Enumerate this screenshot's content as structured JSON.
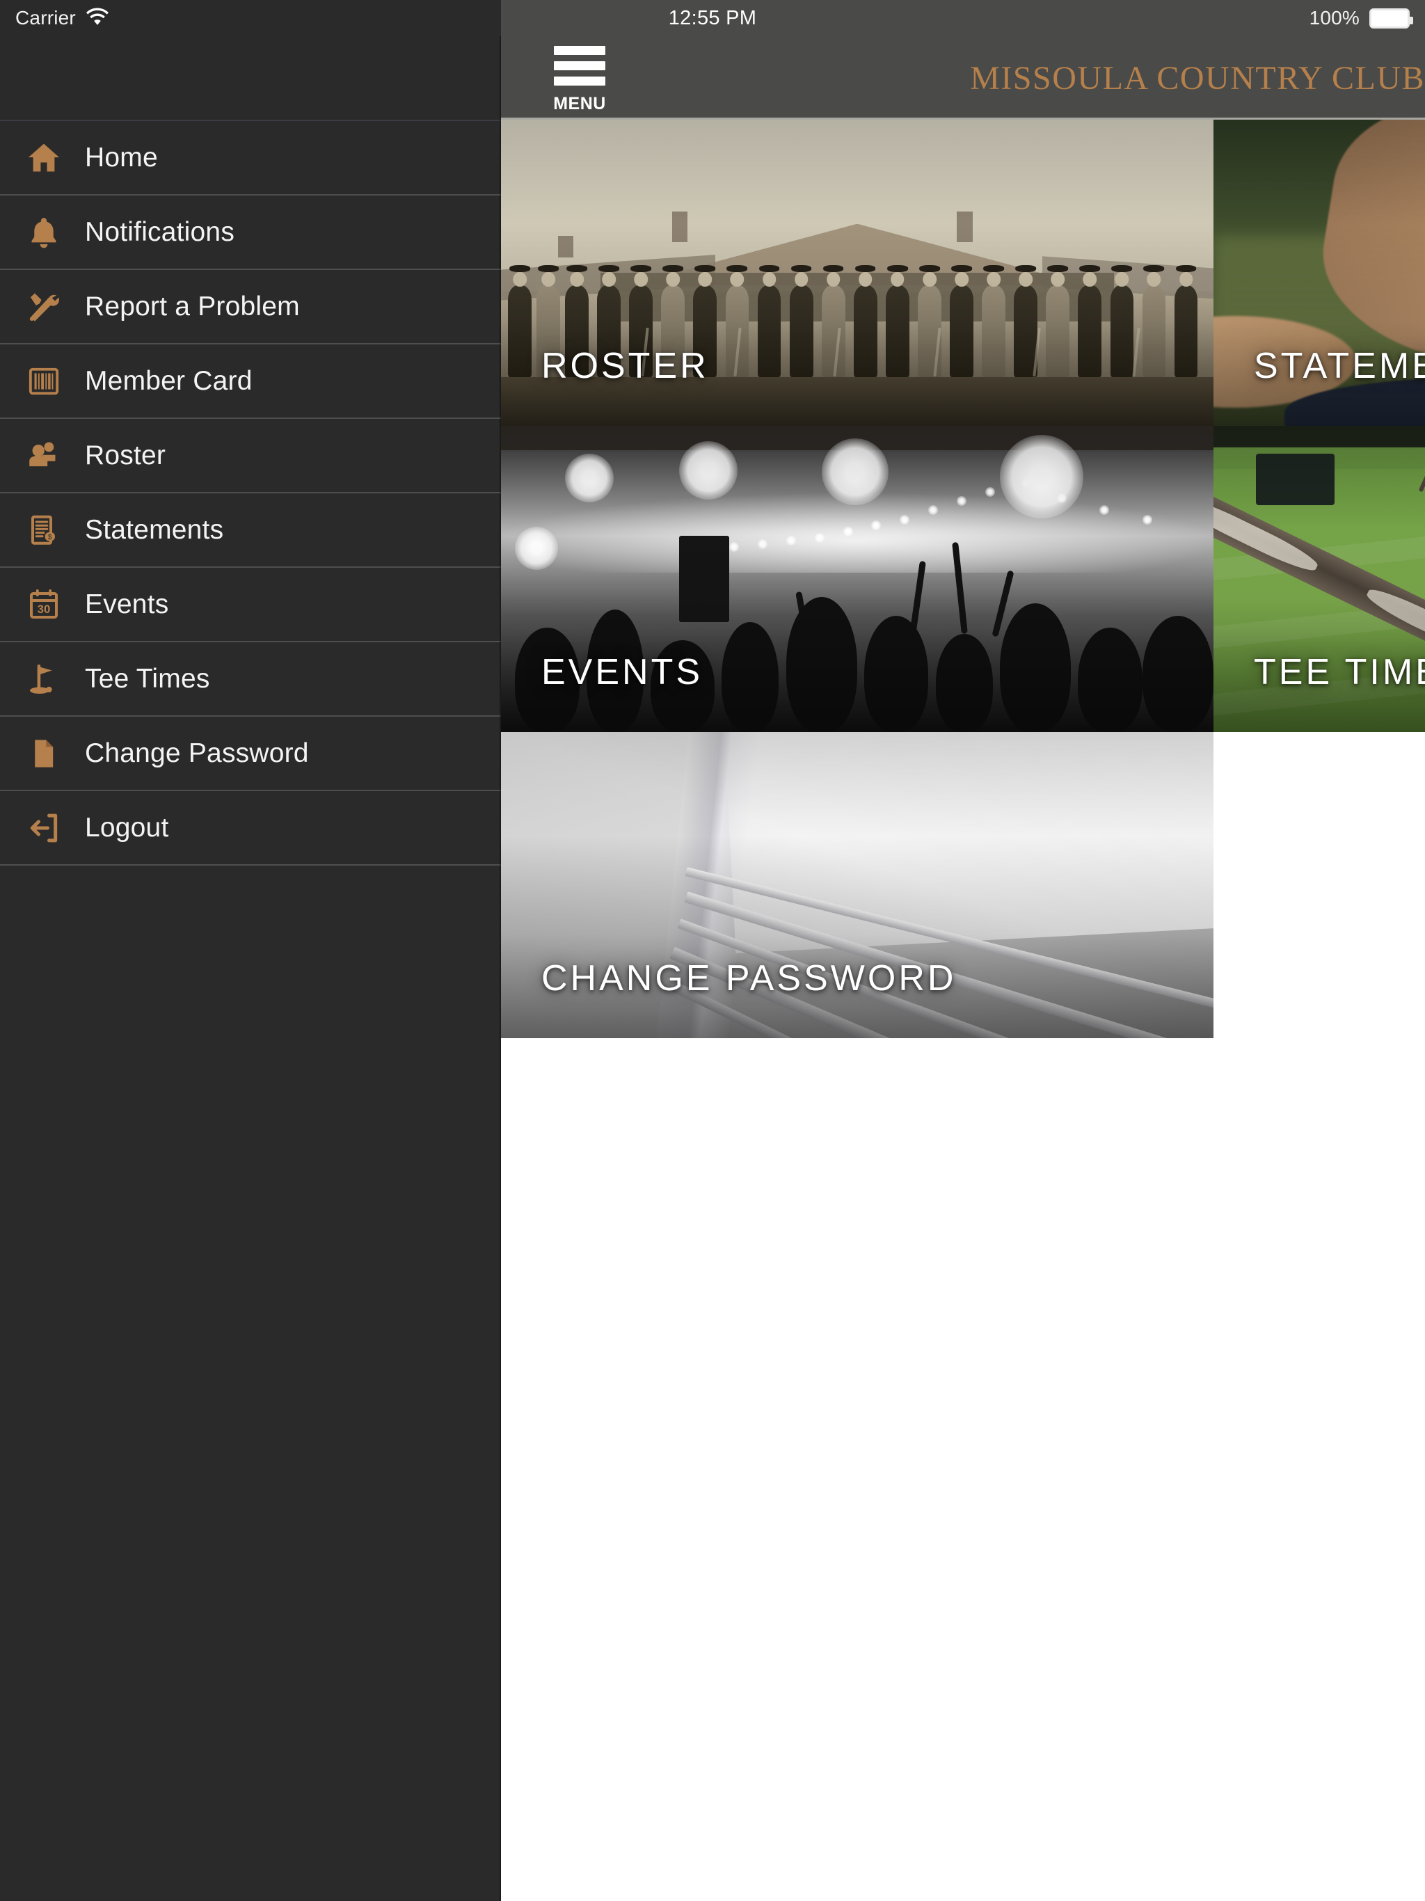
{
  "status_bar": {
    "carrier": "Carrier",
    "wifi_icon": "wifi-icon",
    "time": "12:55 PM",
    "battery_percent": "100%",
    "battery_icon": "battery-full-icon"
  },
  "header": {
    "menu_button_label": "MENU",
    "menu_icon": "hamburger-menu-icon",
    "club_title": "MISSOULA COUNTRY CLUB",
    "title_color": "#b5804b",
    "bar_color": "#4a4a48"
  },
  "drawer": {
    "background_color": "#2a2a2a",
    "icon_color": "#b5804b",
    "items": [
      {
        "label": "Home",
        "icon": "home-icon"
      },
      {
        "label": "Notifications",
        "icon": "bell-icon"
      },
      {
        "label": "Report a Problem",
        "icon": "tools-icon"
      },
      {
        "label": "Member Card",
        "icon": "barcode-icon"
      },
      {
        "label": "Roster",
        "icon": "people-icon"
      },
      {
        "label": "Statements",
        "icon": "invoice-dollar-icon"
      },
      {
        "label": "Events",
        "icon": "calendar-30-icon"
      },
      {
        "label": "Tee Times",
        "icon": "golf-flag-icon"
      },
      {
        "label": "Change Password",
        "icon": "document-icon"
      },
      {
        "label": "Logout",
        "icon": "logout-arrow-icon"
      }
    ]
  },
  "content": {
    "tiles": [
      {
        "label": "ROSTER",
        "art": "vintage-group-photo"
      },
      {
        "label": "STATEMENTS",
        "art": "golfer-arm-on-green"
      },
      {
        "label": "EVENTS",
        "art": "crowd-under-string-lights"
      },
      {
        "label": "TEE TIMES",
        "art": "tree-branch-over-fairway"
      },
      {
        "label": "CHANGE PASSWORD",
        "art": "stack-of-paper"
      }
    ]
  }
}
